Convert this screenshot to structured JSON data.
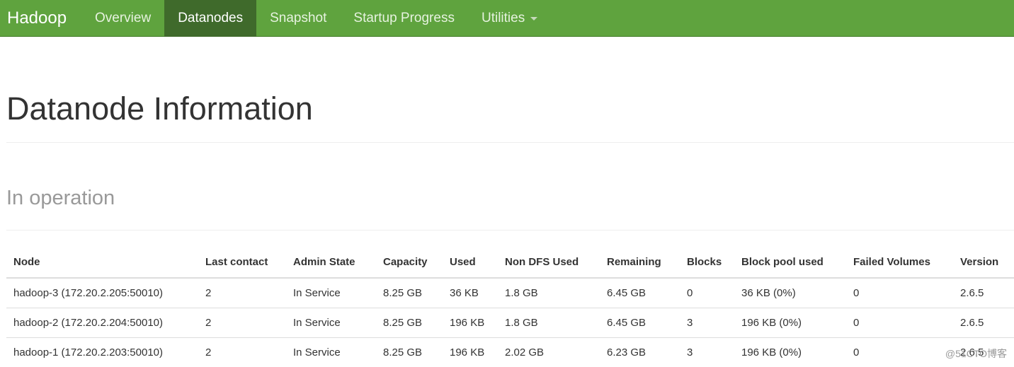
{
  "navbar": {
    "brand": "Hadoop",
    "items": [
      {
        "label": "Overview"
      },
      {
        "label": "Datanodes"
      },
      {
        "label": "Snapshot"
      },
      {
        "label": "Startup Progress"
      },
      {
        "label": "Utilities"
      }
    ]
  },
  "page": {
    "title": "Datanode Information",
    "section": "In operation"
  },
  "table": {
    "headers": [
      "Node",
      "Last contact",
      "Admin State",
      "Capacity",
      "Used",
      "Non DFS Used",
      "Remaining",
      "Blocks",
      "Block pool used",
      "Failed Volumes",
      "Version"
    ],
    "rows": [
      [
        "hadoop-3 (172.20.2.205:50010)",
        "2",
        "In Service",
        "8.25 GB",
        "36 KB",
        "1.8 GB",
        "6.45 GB",
        "0",
        "36 KB (0%)",
        "0",
        "2.6.5"
      ],
      [
        "hadoop-2 (172.20.2.204:50010)",
        "2",
        "In Service",
        "8.25 GB",
        "196 KB",
        "1.8 GB",
        "6.45 GB",
        "3",
        "196 KB (0%)",
        "0",
        "2.6.5"
      ],
      [
        "hadoop-1 (172.20.2.203:50010)",
        "2",
        "In Service",
        "8.25 GB",
        "196 KB",
        "2.02 GB",
        "6.23 GB",
        "3",
        "196 KB (0%)",
        "0",
        "2.6.5"
      ]
    ]
  },
  "watermark": "@51CTO博客",
  "colors": {
    "navbar": "#5fa33e",
    "navbar_active": "#3f6a2b"
  }
}
